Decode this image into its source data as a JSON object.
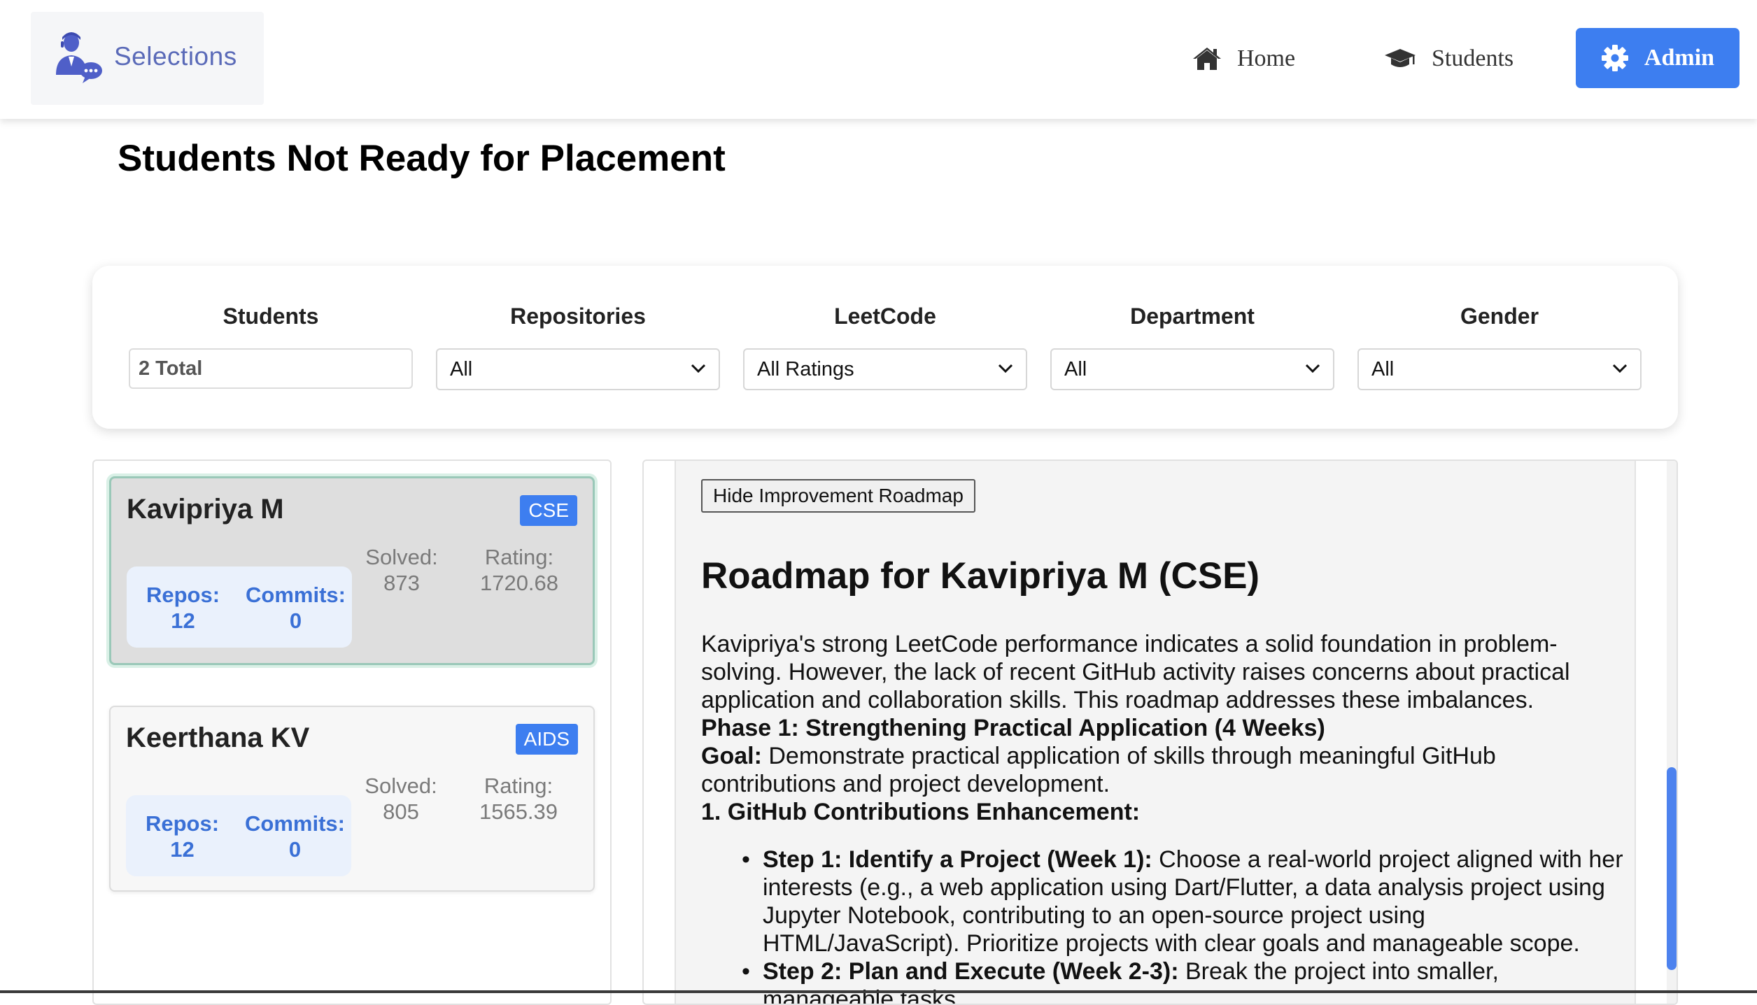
{
  "nav": {
    "brand": "Selections",
    "home": "Home",
    "students": "Students",
    "admin": "Admin"
  },
  "page_title": "Students Not Ready for Placement",
  "filters": {
    "students": {
      "label": "Students",
      "value": "2 Total"
    },
    "repositories": {
      "label": "Repositories",
      "value": "All"
    },
    "leetcode": {
      "label": "LeetCode",
      "value": "All Ratings"
    },
    "department": {
      "label": "Department",
      "value": "All"
    },
    "gender": {
      "label": "Gender",
      "value": "All"
    }
  },
  "students": [
    {
      "name": "Kavipriya M",
      "dept": "CSE",
      "repos_label": "Repos:",
      "repos": "12",
      "commits_label": "Commits:",
      "commits": "0",
      "solved_label": "Solved:",
      "solved": "873",
      "rating_label": "Rating:",
      "rating": "1720.68"
    },
    {
      "name": "Keerthana KV",
      "dept": "AIDS",
      "repos_label": "Repos:",
      "repos": "12",
      "commits_label": "Commits:",
      "commits": "0",
      "solved_label": "Solved:",
      "solved": "805",
      "rating_label": "Rating:",
      "rating": "1565.39"
    }
  ],
  "roadmap": {
    "hide_button": "Hide Improvement Roadmap",
    "title": "Roadmap for Kavipriya M (CSE)",
    "intro": "Kavipriya's strong LeetCode performance indicates a solid foundation in problem-solving. However, the lack of recent GitHub activity raises concerns about practical application and collaboration skills. This roadmap addresses these imbalances.",
    "phase1": "Phase 1: Strengthening Practical Application (4 Weeks)",
    "goal_label": "Goal:",
    "goal_text": " Demonstrate practical application of skills through meaningful GitHub contributions and project development.",
    "section1": "1. GitHub Contributions Enhancement:",
    "steps": [
      {
        "label": "Step 1: Identify a Project (Week 1):",
        "text": " Choose a real-world project aligned with her interests (e.g., a web application using Dart/Flutter, a data analysis project using Jupyter Notebook, contributing to an open-source project using HTML/JavaScript). Prioritize projects with clear goals and manageable scope."
      },
      {
        "label": "Step 2: Plan and Execute (Week 2-3):",
        "text": " Break the project into smaller, manageable tasks."
      }
    ]
  }
}
